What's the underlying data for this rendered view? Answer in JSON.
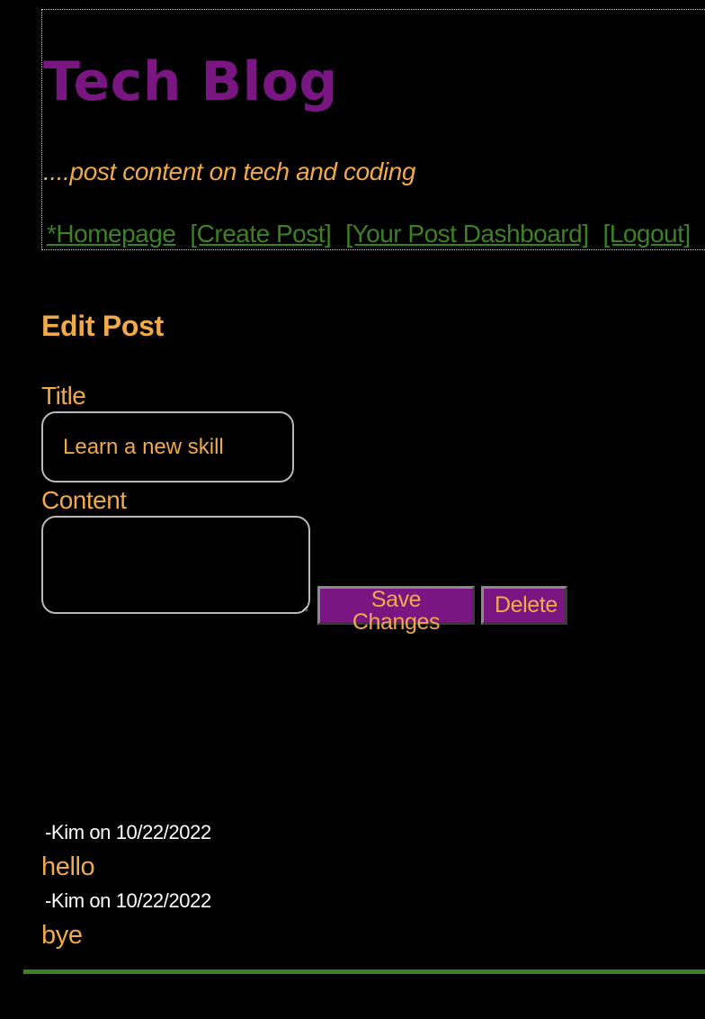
{
  "header": {
    "title": "Tech Blog",
    "tagline": "....post content on tech and coding"
  },
  "nav": {
    "homepage": "*Homepage",
    "create_post": "[Create Post]",
    "dashboard": "[Your Post Dashboard]",
    "logout": "[Logout]"
  },
  "edit_post": {
    "heading": "Edit Post",
    "title_label": "Title",
    "title_value": "Learn a new skill",
    "content_label": "Content",
    "content_value": "",
    "save_label": "Save Changes",
    "delete_label": "Delete"
  },
  "comments": [
    {
      "meta": "-Kim on 10/22/2022",
      "text": "hello"
    },
    {
      "meta": "-Kim on 10/22/2022",
      "text": "bye"
    }
  ],
  "colors": {
    "background": "#000000",
    "brand_purple": "#7a1682",
    "accent_orange": "#f0a94b",
    "link_green": "#3d8125"
  }
}
